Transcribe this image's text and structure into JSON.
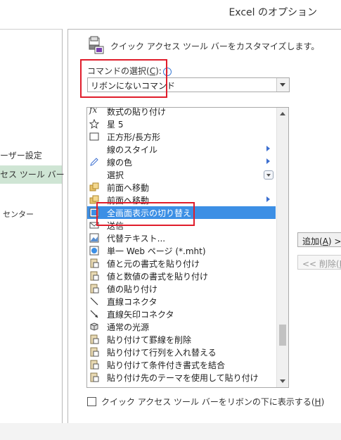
{
  "window": {
    "title": "Excel のオプション"
  },
  "left_nav": {
    "items": [
      {
        "label": "ーザー設定",
        "selected": false
      },
      {
        "label": "セス ツール バー",
        "selected": true
      },
      {
        "label": "センター",
        "selected": false
      }
    ]
  },
  "header": {
    "description": "クイック アクセス ツール バーをカスタマイズします。",
    "icon": "customize-qat-icon"
  },
  "command_select": {
    "label": "コマンドの選択(",
    "accesskey": "C",
    "label_end": "):",
    "info_icon": "info-icon",
    "value": "リボンにないコマンド"
  },
  "command_list": {
    "items": [
      {
        "label": "数式の貼り付け",
        "icon": "function-fx-icon"
      },
      {
        "label": "星 5",
        "icon": "star-icon"
      },
      {
        "label": "正方形/長方形",
        "icon": "rectangle-icon"
      },
      {
        "label": "線のスタイル",
        "icon": "",
        "submenu": true
      },
      {
        "label": "線の色",
        "icon": "pen-icon",
        "submenu": true
      },
      {
        "label": "選択",
        "icon": "",
        "dropdown": true
      },
      {
        "label": "前面へ移動",
        "icon": "bring-forward-icon"
      },
      {
        "label": "前面へ移動",
        "icon": "bring-forward-icon",
        "submenu": true
      },
      {
        "label": "全画面表示の切り替え",
        "icon": "full-screen-icon",
        "selected": true
      },
      {
        "label": "送信",
        "icon": "send-icon"
      },
      {
        "label": "代替テキスト...",
        "icon": "alt-text-icon"
      },
      {
        "label": "単一 Web ページ (*.mht)",
        "icon": "web-page-icon"
      },
      {
        "label": "値と元の書式を貼り付け",
        "icon": "paste-values-source-format-icon"
      },
      {
        "label": "値と数値の書式を貼り付け",
        "icon": "paste-values-number-format-icon"
      },
      {
        "label": "値の貼り付け",
        "icon": "paste-values-icon"
      },
      {
        "label": "直線コネクタ",
        "icon": "straight-connector-icon"
      },
      {
        "label": "直線矢印コネクタ",
        "icon": "arrow-connector-icon"
      },
      {
        "label": "通常の光源",
        "icon": "cube-icon"
      },
      {
        "label": "貼り付けて罫線を削除",
        "icon": "paste-no-borders-icon"
      },
      {
        "label": "貼り付けて行列を入れ替える",
        "icon": "paste-transpose-icon"
      },
      {
        "label": "貼り付けて条件付き書式を結合",
        "icon": "paste-merge-cf-icon"
      },
      {
        "label": "貼り付け先のテーマを使用して貼り付け",
        "icon": "paste-destination-theme-icon"
      }
    ]
  },
  "buttons": {
    "add_label": "追加(",
    "add_accesskey": "A",
    "add_end": ") >",
    "remove_label": "<< 削除(",
    "remove_accesskey": "R",
    "remove_end": ")"
  },
  "footer": {
    "checkbox_label": "クイック アクセス ツール バーをリボンの下に表示する(",
    "checkbox_accesskey": "H",
    "checkbox_end": ")",
    "checked": false
  },
  "colors": {
    "selection": "#3c8fe5",
    "nav_selected": "#cfe5d4",
    "highlight_box": "#e01d2b"
  }
}
